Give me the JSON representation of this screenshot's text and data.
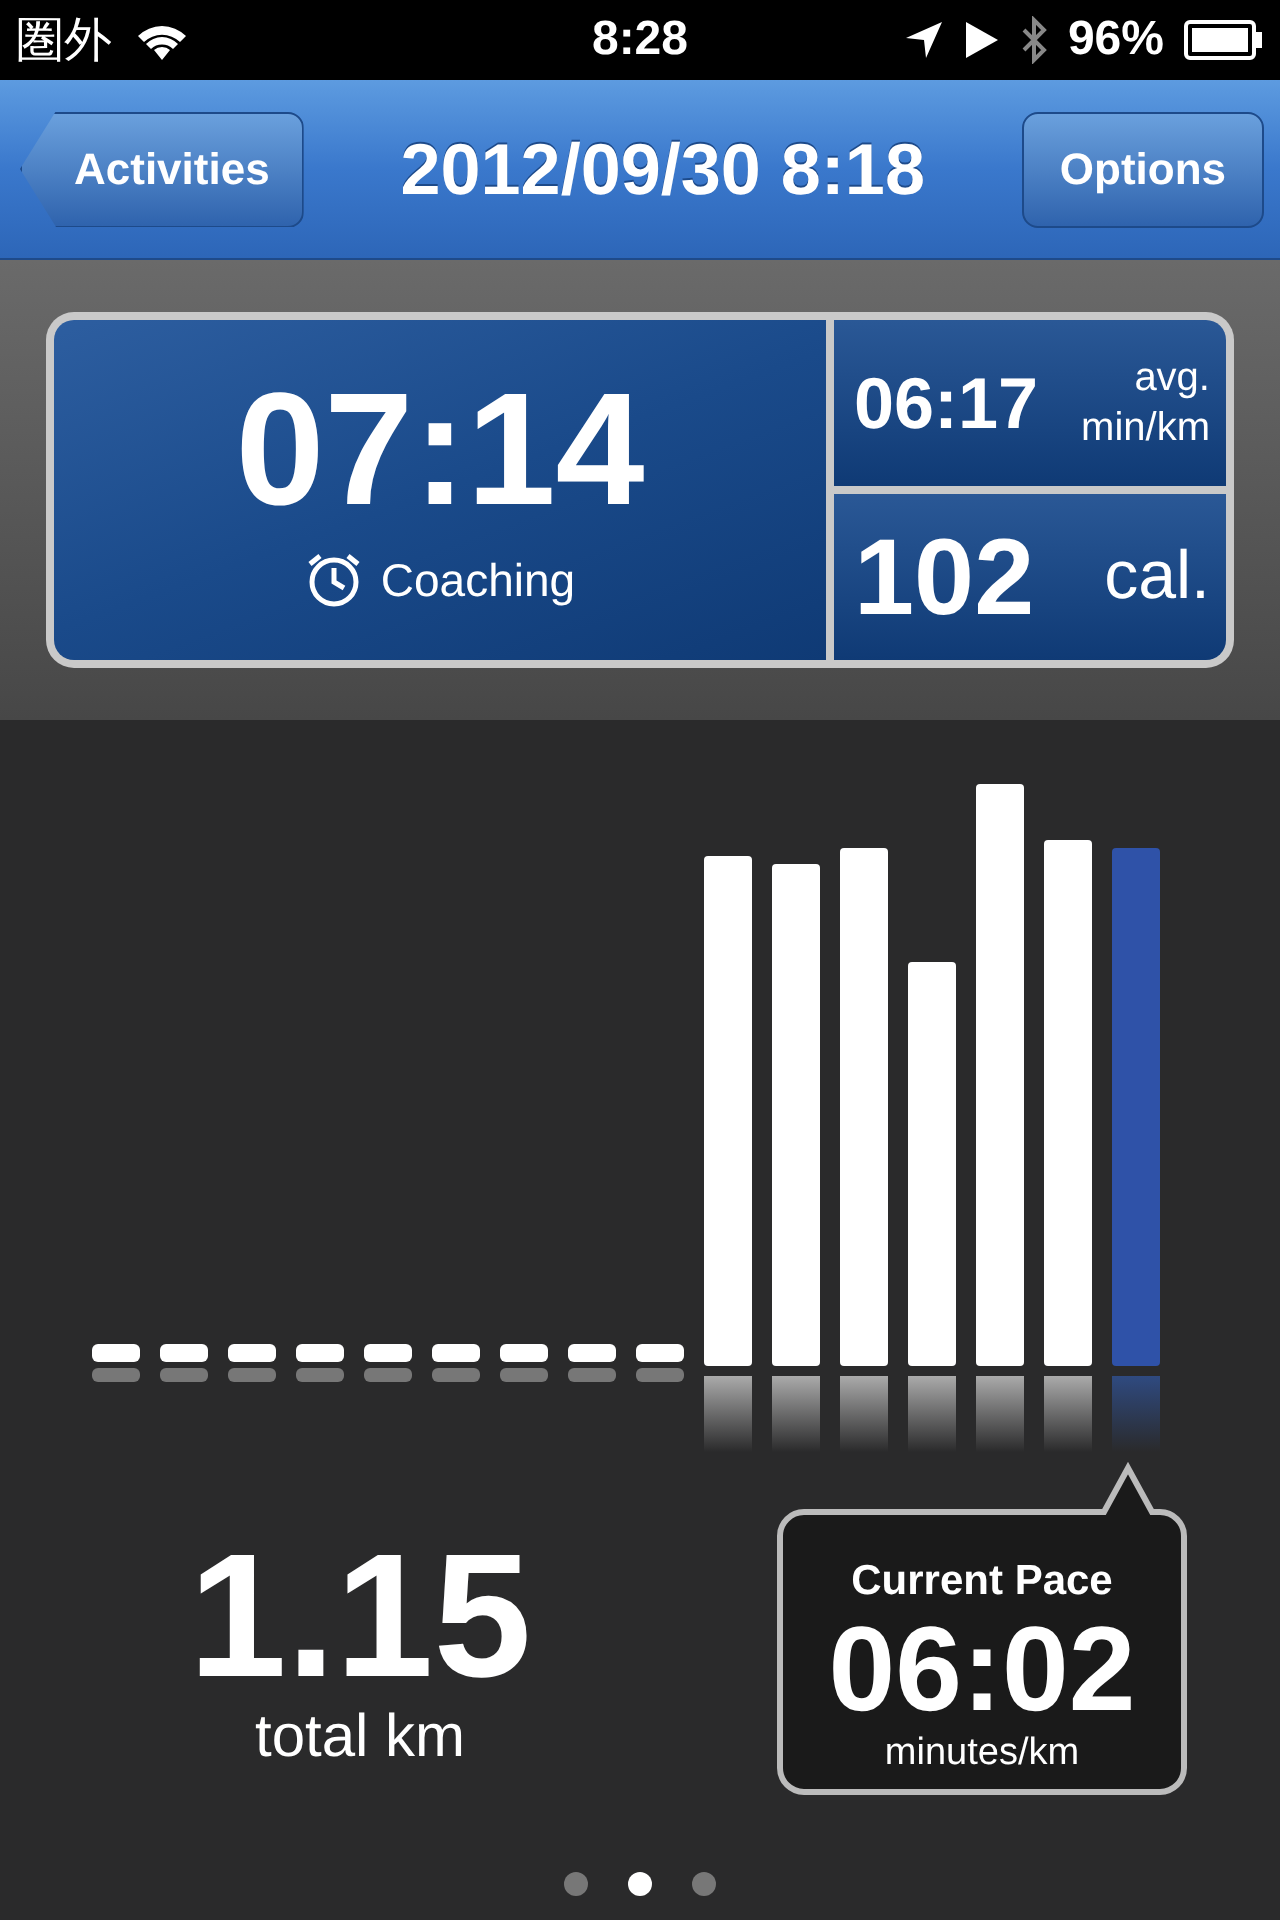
{
  "status_bar": {
    "carrier": "圏外",
    "time": "8:28",
    "battery": "96%"
  },
  "nav_bar": {
    "back_button": "Activities",
    "title": "2012/09/30 8:18",
    "options_button": "Options"
  },
  "stats": {
    "duration": "07:14",
    "mode": "Coaching",
    "avg_pace": "06:17",
    "avg_pace_unit_line_1": "avg.",
    "avg_pace_unit_line_2": "min/km",
    "calories": "102",
    "calories_unit": "cal."
  },
  "total": {
    "distance": "1.15",
    "label": "total km"
  },
  "current_pace": {
    "title": "Current Pace",
    "value": "06:02",
    "unit": "minutes/km"
  },
  "pages": [
    {
      "selected": false
    },
    {
      "selected": true
    },
    {
      "selected": false
    }
  ]
}
